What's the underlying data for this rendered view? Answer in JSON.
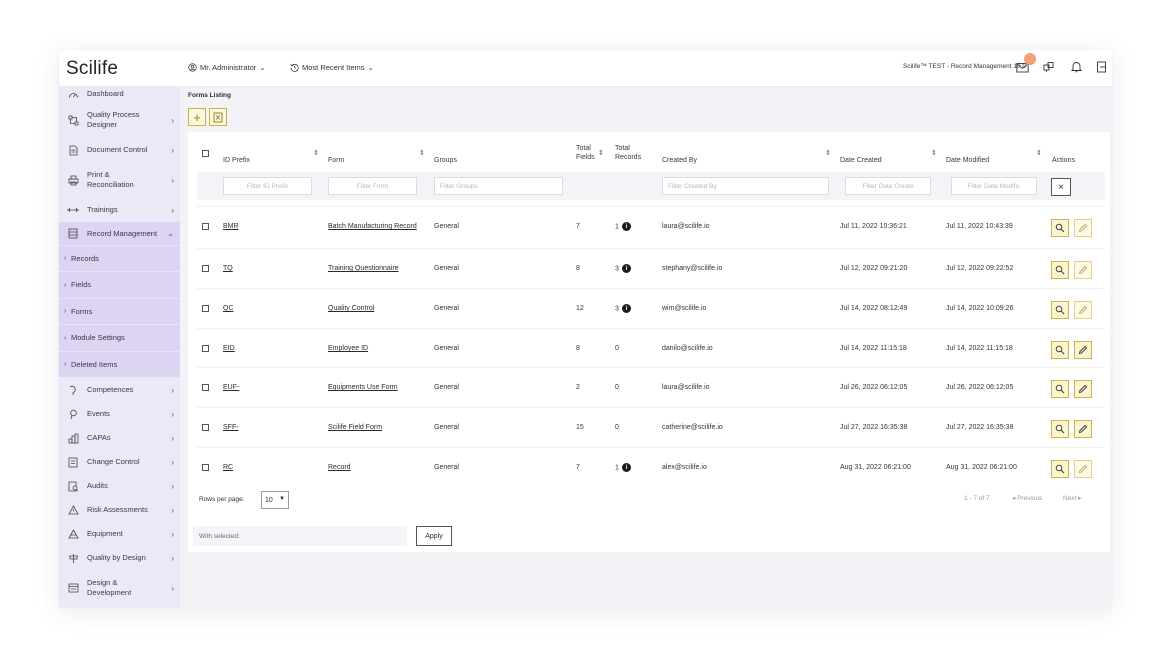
{
  "app": {
    "logo": "Scilife",
    "user_menu": "Mr. Administrator",
    "recent_menu": "Most Recent Items",
    "context": "Scilife™ TEST - Record Management 10.0"
  },
  "sidebar": {
    "items": [
      {
        "label": "Dashboard",
        "icon": "dashboard-icon"
      },
      {
        "label": "Quality Process Designer",
        "icon": "process-icon"
      },
      {
        "label": "Document Control",
        "icon": "document-icon"
      },
      {
        "label": "Print & Reconciliation",
        "icon": "print-icon"
      },
      {
        "label": "Trainings",
        "icon": "training-icon"
      },
      {
        "label": "Record Management",
        "icon": "record-icon"
      },
      {
        "label": "Competences",
        "icon": "competence-icon"
      },
      {
        "label": "Events",
        "icon": "event-icon"
      },
      {
        "label": "CAPAs",
        "icon": "capa-icon"
      },
      {
        "label": "Change Control",
        "icon": "change-icon"
      },
      {
        "label": "Audits",
        "icon": "audit-icon"
      },
      {
        "label": "Risk Assessments",
        "icon": "risk-icon"
      },
      {
        "label": "Equipment",
        "icon": "equipment-icon"
      },
      {
        "label": "Quality by Design",
        "icon": "quality-design-icon"
      },
      {
        "label": "Design & Development",
        "icon": "design-dev-icon"
      }
    ],
    "subitems": [
      "Records",
      "Fields",
      "Forms",
      "Module Settings",
      "Deleted Items"
    ]
  },
  "page": {
    "title": "Forms Listing"
  },
  "table": {
    "columns": {
      "id_prefix": "ID Prefix",
      "form": "Form",
      "groups": "Groups",
      "total_fields": "Total Fields",
      "total_records": "Total Records",
      "created_by": "Created By",
      "date_created": "Date Created",
      "date_modified": "Date Modified",
      "actions": "Actions"
    },
    "filters": {
      "id_prefix": "Filter ID Prefix",
      "form": "Filter Form",
      "groups": "Filter Groups",
      "created_by": "Filter Created By",
      "date_created": "Filter Date Create",
      "date_modified": "Filter Date Modific"
    },
    "rows": [
      {
        "id": "BMR",
        "form": "Batch Manufacturing Record",
        "group": "General",
        "fields": "7",
        "records": "1",
        "info": true,
        "created_by": "laura@scilife.io",
        "created": "Jul 11, 2022 10:36:21",
        "modified": "Jul 11, 2022 10:43:39"
      },
      {
        "id": "TQ",
        "form": "Training Questionnaire",
        "group": "General",
        "fields": "8",
        "records": "3",
        "info": true,
        "created_by": "stephany@scilife.io",
        "created": "Jul 12, 2022 09:21:20",
        "modified": "Jul 12, 2022 09:22:52"
      },
      {
        "id": "QC",
        "form": "Quality Control",
        "group": "General",
        "fields": "12",
        "records": "3",
        "info": true,
        "created_by": "wim@scilife.io",
        "created": "Jul 14, 2022 08:12:49",
        "modified": "Jul 14, 2022 10:09:26"
      },
      {
        "id": "EID",
        "form": "Employee ID",
        "group": "General",
        "fields": "8",
        "records": "0",
        "info": false,
        "created_by": "danilo@scilife.io",
        "created": "Jul 14, 2022 11:15:18",
        "modified": "Jul 14, 2022 11:15:18"
      },
      {
        "id": "EUF-",
        "form": "Equipments Use Form",
        "group": "General",
        "fields": "2",
        "records": "0",
        "info": false,
        "created_by": "laura@scilife.io",
        "created": "Jul 26, 2022 06:12:05",
        "modified": "Jul 26, 2022 06:12:05"
      },
      {
        "id": "SFF-",
        "form": "Scilife Field Form",
        "group": "General",
        "fields": "15",
        "records": "0",
        "info": false,
        "created_by": "catherine@scilife.io",
        "created": "Jul 27, 2022 16:35:38",
        "modified": "Jul 27, 2022 16:35:38"
      },
      {
        "id": "RC",
        "form": "Record",
        "group": "General",
        "fields": "7",
        "records": "1",
        "info": true,
        "created_by": "alex@scilife.io",
        "created": "Aug 31, 2022 06:21:00",
        "modified": "Aug 31, 2022 06:21:00"
      }
    ]
  },
  "pagination": {
    "rows_per_page_label": "Rows per page:",
    "rows_per_page": "10",
    "range": "1 - 7 of 7",
    "previous": "Previous",
    "next": "Next"
  },
  "bulk": {
    "placeholder": "With selected:",
    "apply": "Apply"
  },
  "colors": {
    "sidebar_bg": "#ece9f7",
    "sidebar_active": "#ddd3f3",
    "action_border": "#c9b44d",
    "action_bg": "#fbf4cf",
    "badge": "#f3a07a"
  }
}
